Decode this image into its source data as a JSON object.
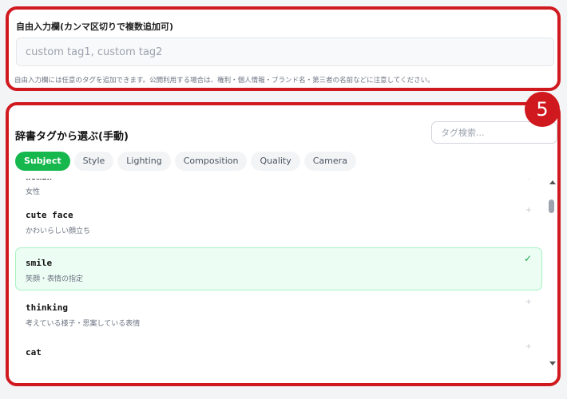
{
  "free_input": {
    "label": "自由入力欄(カンマ区切りで複数追加可)",
    "placeholder": "custom tag1, custom tag2",
    "note": "自由入力欄には任意のタグを追加できます。公開利用する場合は、権利・個人情報・ブランド名・第三者の名前などに注意してください。"
  },
  "dictionary": {
    "title": "辞書タグから選ぶ(手動)",
    "search_placeholder": "タグ検索...",
    "tabs": [
      {
        "label": "Subject",
        "active": true
      },
      {
        "label": "Style"
      },
      {
        "label": "Lighting"
      },
      {
        "label": "Composition"
      },
      {
        "label": "Quality"
      },
      {
        "label": "Camera"
      }
    ],
    "items": [
      {
        "tag": "woman",
        "desc": "女性",
        "mark": "+"
      },
      {
        "tag": "cute face",
        "desc": "かわいらしい顔立ち",
        "mark": "+"
      },
      {
        "tag": "smile",
        "desc": "笑顔・表情の指定",
        "mark": "✓",
        "selected": true
      },
      {
        "tag": "thinking",
        "desc": "考えている様子・思案している表情",
        "mark": "+"
      },
      {
        "tag": "cat",
        "desc": "",
        "mark": "+"
      }
    ]
  },
  "step_badge": "5",
  "colors": {
    "highlight_border": "#d0191f",
    "accent_green": "#16b84d",
    "selected_bg": "#ecfdf3"
  }
}
